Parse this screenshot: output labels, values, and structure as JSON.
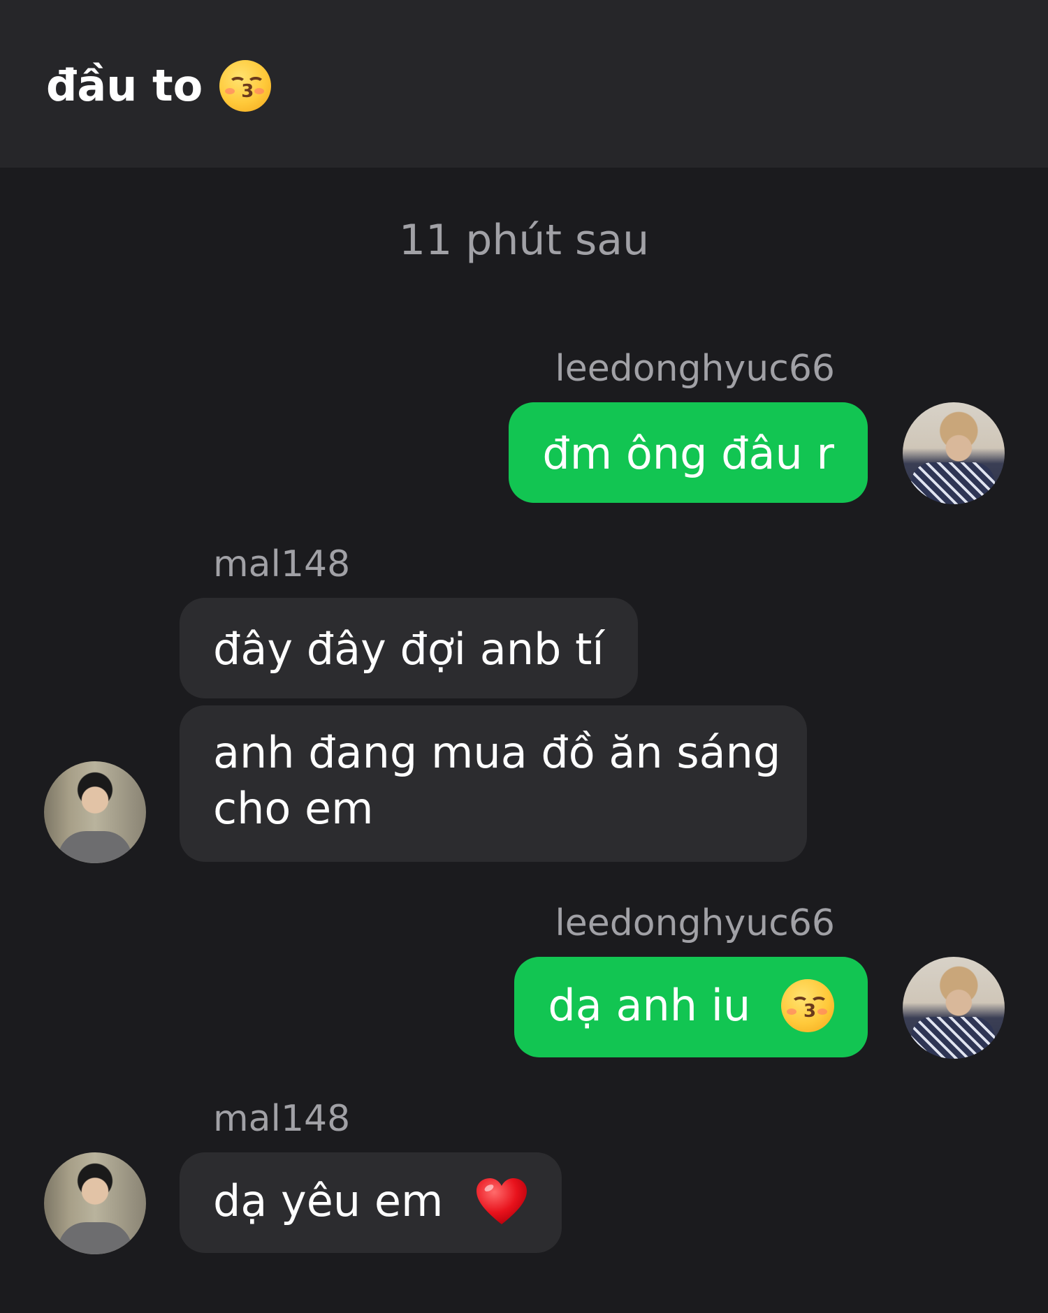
{
  "header": {
    "title": "đầu to",
    "title_emoji": "kissing-face-with-closed-eyes"
  },
  "timestamp": "11 phút sau",
  "messages": [
    {
      "sender": "leedonghyuc66",
      "direction": "outgoing",
      "text": "đm ông đâu r"
    },
    {
      "sender": "mal148",
      "direction": "incoming",
      "text": "đây đây đợi anb tí"
    },
    {
      "direction": "incoming",
      "text_line1": "anh đang mua đồ ăn sáng",
      "text_line2": "cho em"
    },
    {
      "sender": "leedonghyuc66",
      "direction": "outgoing",
      "text": "dạ anh iu",
      "emoji": "kissing-face-with-closed-eyes"
    },
    {
      "sender": "mal148",
      "direction": "incoming",
      "text": "dạ yêu em",
      "emoji": "red-heart"
    }
  ],
  "colors": {
    "background": "#1b1b1e",
    "header": "#262629",
    "outgoing_bubble": "#12c552",
    "incoming_bubble": "#2c2c2f",
    "secondary_text": "#a1a1a6"
  }
}
